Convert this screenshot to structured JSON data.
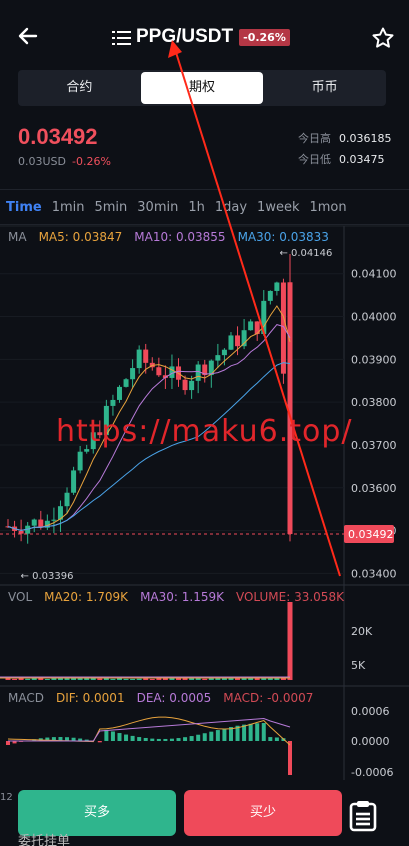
{
  "header": {
    "pair": "PPG/USDT",
    "change_badge": "-0.26%"
  },
  "segments": [
    "合约",
    "期权",
    "币币"
  ],
  "active_segment": 1,
  "ticker": {
    "price": "0.03492",
    "usd_line": "0.03USD",
    "change": "-0.26%",
    "high_label": "今日高",
    "high_value": "0.036185",
    "low_label": "今日低",
    "low_value": "0.03475"
  },
  "timeframes": [
    "Time",
    "1min",
    "5min",
    "30min",
    "1h",
    "1day",
    "1week",
    "1mon"
  ],
  "active_timeframe": 0,
  "main_indicators": {
    "name": "MA",
    "ma5": "MA5: 0.03847",
    "ma10": "MA10: 0.03855",
    "ma30": "MA30: 0.03833"
  },
  "vol_indicators": {
    "name": "VOL",
    "ma20": "MA20: 1.709K",
    "ma30": "MA30: 1.159K",
    "volume": "VOLUME: 33.058K"
  },
  "macd_indicators": {
    "name": "MACD",
    "dif": "DIF: 0.0001",
    "dea": "DEA: 0.0005",
    "macd": "MACD: -0.0007"
  },
  "price_axis": [
    "0.04100",
    "0.04000",
    "0.03900",
    "0.03800",
    "0.03700",
    "0.03600",
    "0.03500",
    "0.03400"
  ],
  "vol_axis": [
    "20K",
    "5K"
  ],
  "macd_axis": [
    "0.0006",
    "0.0000",
    "-0.0006"
  ],
  "max_label": "0.04146",
  "min_label": "0.03396",
  "last_price_tag": "0.03492",
  "footer_time": "12",
  "buttons": {
    "buy": "买多",
    "sell": "买少"
  },
  "footer_label": "委托挂单",
  "watermark": "https://maku6.top/",
  "colors": {
    "up": "#2fb58d",
    "down": "#ef4a5a",
    "accent": "#3f82f4",
    "ma5": "#e8a33d",
    "ma10": "#b77ad8",
    "ma30": "#4aa3e8"
  },
  "chart_data": {
    "type": "candlestick",
    "price_range": [
      0.0338,
      0.0416
    ],
    "high": 0.04146,
    "low": 0.03396,
    "last": 0.03492,
    "series": []
  }
}
